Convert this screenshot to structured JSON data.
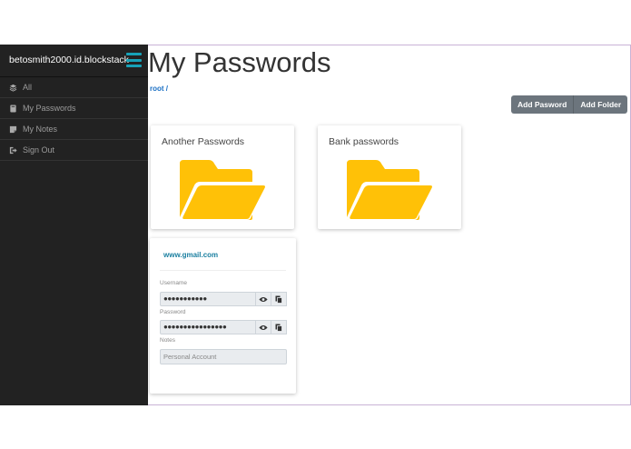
{
  "sidebar": {
    "brand": "betosmith2000.id.blockstack",
    "items": [
      {
        "label": "All",
        "icon": "layers-icon"
      },
      {
        "label": "My Passwords",
        "icon": "book-icon"
      },
      {
        "label": "My Notes",
        "icon": "note-icon"
      },
      {
        "label": "Sign Out",
        "icon": "sign-out-icon"
      }
    ]
  },
  "main": {
    "title": "My Passwords",
    "breadcrumb": "root /",
    "buttons": {
      "add_password": "Add Pasword",
      "add_folder": "Add Folder"
    },
    "folders": [
      {
        "label": "Another Passwords"
      },
      {
        "label": "Bank passwords"
      }
    ],
    "entry": {
      "site": "www.gmail.com",
      "username_label": "Username",
      "username_value": "●●●●●●●●●●●",
      "password_label": "Password",
      "password_value": "●●●●●●●●●●●●●●●●",
      "notes_label": "Notes",
      "notes_value": "Personal Account"
    }
  },
  "colors": {
    "sidebar_bg": "#222222",
    "accent": "#17a2b8",
    "folder": "#ffc107",
    "button_bg": "#6c757d"
  }
}
